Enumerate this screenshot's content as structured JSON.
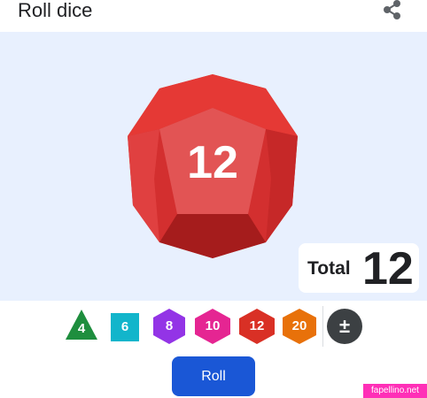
{
  "header": {
    "title": "Roll dice"
  },
  "die": {
    "value": "12",
    "color": "#d32f2f"
  },
  "total": {
    "label": "Total",
    "value": "12"
  },
  "dice_options": [
    {
      "label": "4",
      "shape": "triangle-icon",
      "color": "#1e8e3e"
    },
    {
      "label": "6",
      "shape": "square-icon",
      "color": "#12b5cb"
    },
    {
      "label": "8",
      "shape": "hexagon-icon",
      "color": "#9334e6"
    },
    {
      "label": "10",
      "shape": "hexagon-icon",
      "color": "#e52592"
    },
    {
      "label": "12",
      "shape": "hexagon-icon",
      "color": "#d93025"
    },
    {
      "label": "20",
      "shape": "hexagon-icon",
      "color": "#e8710a"
    }
  ],
  "modifier": {
    "label": "±",
    "color": "#3c4043"
  },
  "roll_button": {
    "label": "Roll",
    "color": "#1a57d6"
  },
  "watermark": "fapellino.net"
}
